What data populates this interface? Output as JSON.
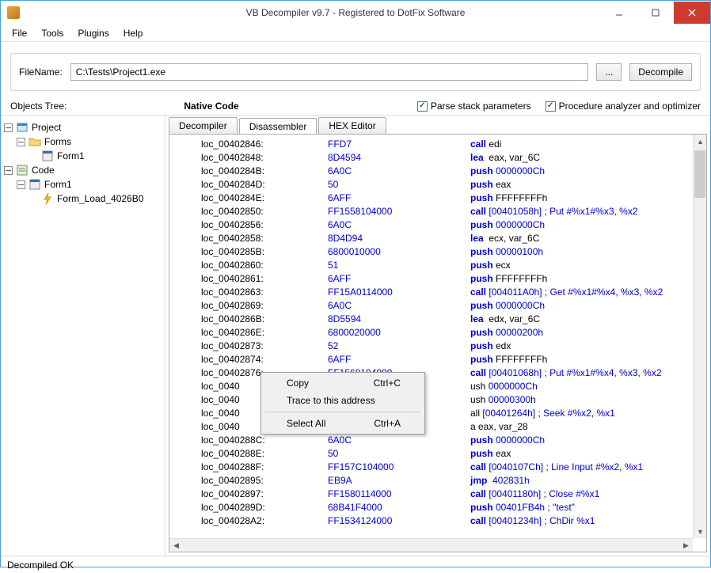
{
  "window": {
    "title": "VB Decompiler v9.7 - Registered to DotFix Software"
  },
  "menu": {
    "file": "File",
    "tools": "Tools",
    "plugins": "Plugins",
    "help": "Help"
  },
  "toolbar": {
    "file_label": "FileName:",
    "file_value": "C:\\Tests\\Project1.exe",
    "browse": "...",
    "decompile": "Decompile"
  },
  "options": {
    "tree_label": "Objects Tree:",
    "center_label": "Native Code",
    "parse_stack": "Parse stack parameters",
    "proc_analyzer": "Procedure analyzer and optimizer"
  },
  "tree": {
    "project": "Project",
    "forms": "Forms",
    "form1a": "Form1",
    "code": "Code",
    "form1b": "Form1",
    "form_load": "Form_Load_4026B0"
  },
  "tabs": {
    "decompiler": "Decompiler",
    "disassembler": "Disassembler",
    "hex": "HEX Editor"
  },
  "code": [
    {
      "loc": "loc_00402846:",
      "hex": "FFD7",
      "ins": "call",
      "arg": "edi"
    },
    {
      "loc": "loc_00402848:",
      "hex": "8D4594",
      "ins": "lea",
      "arg": "eax, var_6C"
    },
    {
      "loc": "loc_0040284B:",
      "hex": "6A0C",
      "ins": "push",
      "arg": "0000000Ch",
      "arg_ref": true
    },
    {
      "loc": "loc_0040284D:",
      "hex": "50",
      "ins": "push",
      "arg": "eax"
    },
    {
      "loc": "loc_0040284E:",
      "hex": "6AFF",
      "ins": "push",
      "arg": "FFFFFFFFh"
    },
    {
      "loc": "loc_00402850:",
      "hex": "FF1558104000",
      "ins": "call",
      "arg": "[00401058h]",
      "arg_ref": true,
      "cmt": "; Put #%x1#%x3, %x2"
    },
    {
      "loc": "loc_00402856:",
      "hex": "6A0C",
      "ins": "push",
      "arg": "0000000Ch",
      "arg_ref": true
    },
    {
      "loc": "loc_00402858:",
      "hex": "8D4D94",
      "ins": "lea",
      "arg": "ecx, var_6C"
    },
    {
      "loc": "loc_0040285B:",
      "hex": "6800010000",
      "ins": "push",
      "arg": "00000100h",
      "arg_ref": true
    },
    {
      "loc": "loc_00402860:",
      "hex": "51",
      "ins": "push",
      "arg": "ecx"
    },
    {
      "loc": "loc_00402861:",
      "hex": "6AFF",
      "ins": "push",
      "arg": "FFFFFFFFh"
    },
    {
      "loc": "loc_00402863:",
      "hex": "FF15A0114000",
      "ins": "call",
      "arg": "[004011A0h]",
      "arg_ref": true,
      "cmt": "; Get #%x1#%x4, %x3, %x2"
    },
    {
      "loc": "loc_00402869:",
      "hex": "6A0C",
      "ins": "push",
      "arg": "0000000Ch",
      "arg_ref": true
    },
    {
      "loc": "loc_0040286B:",
      "hex": "8D5594",
      "ins": "lea",
      "arg": "edx, var_6C"
    },
    {
      "loc": "loc_0040286E:",
      "hex": "6800020000",
      "ins": "push",
      "arg": "00000200h",
      "arg_ref": true
    },
    {
      "loc": "loc_00402873:",
      "hex": "52",
      "ins": "push",
      "arg": "edx"
    },
    {
      "loc": "loc_00402874:",
      "hex": "6AFF",
      "ins": "push",
      "arg": "FFFFFFFFh"
    },
    {
      "loc": "loc_00402876:",
      "hex": "FF1568104000",
      "ins": "call",
      "arg": "[00401068h]",
      "arg_ref": true,
      "cmt": "; Put #%x1#%x4, %x3, %x2",
      "cut": 6
    },
    {
      "loc": "loc_0040",
      "hex": "",
      "ins": "push",
      "arg": "0000000Ch",
      "arg_ref": true,
      "partial": true,
      "partial_ins": "ush"
    },
    {
      "loc": "loc_0040",
      "hex": "",
      "ins": "push",
      "arg": "00000300h",
      "arg_ref": true,
      "partial": true,
      "partial_ins": "ush"
    },
    {
      "loc": "loc_0040",
      "hex": "",
      "ins": "call",
      "arg": "[00401264h]",
      "arg_ref": true,
      "cmt": "; Seek #%x2, %x1",
      "partial": true,
      "partial_ins": "all"
    },
    {
      "loc": "loc_0040",
      "hex": "",
      "ins": "lea",
      "arg": "eax, var_28",
      "partial": true,
      "partial_ins": "a eax, var_28"
    },
    {
      "loc": "loc_0040288C:",
      "hex": "6A0C",
      "ins": "push",
      "arg": "0000000Ch",
      "arg_ref": true
    },
    {
      "loc": "loc_0040288E:",
      "hex": "50",
      "ins": "push",
      "arg": "eax"
    },
    {
      "loc": "loc_0040288F:",
      "hex": "FF157C104000",
      "ins": "call",
      "arg": "[0040107Ch]",
      "arg_ref": true,
      "cmt": "; Line Input #%x2, %x1"
    },
    {
      "loc": "loc_00402895:",
      "hex": "EB9A",
      "ins": "jmp",
      "arg": "402831h",
      "arg_ref": true
    },
    {
      "loc": "loc_00402897:",
      "hex": "FF1580114000",
      "ins": "call",
      "arg": "[00401180h]",
      "arg_ref": true,
      "cmt": "; Close #%x1"
    },
    {
      "loc": "loc_0040289D:",
      "hex": "68B41F4000",
      "ins": "push",
      "arg": "00401FB4h",
      "arg_ref": true,
      "cmt": "; \"test\""
    },
    {
      "loc": "loc_004028A2:",
      "hex": "FF1534124000",
      "ins": "call",
      "arg": "[00401234h]",
      "arg_ref": true,
      "cmt": "; ChDir %x1"
    }
  ],
  "context": {
    "copy": "Copy",
    "copy_key": "Ctrl+C",
    "trace": "Trace to this address",
    "selall": "Select All",
    "selall_key": "Ctrl+A"
  },
  "status": {
    "text": "Decompiled OK"
  }
}
